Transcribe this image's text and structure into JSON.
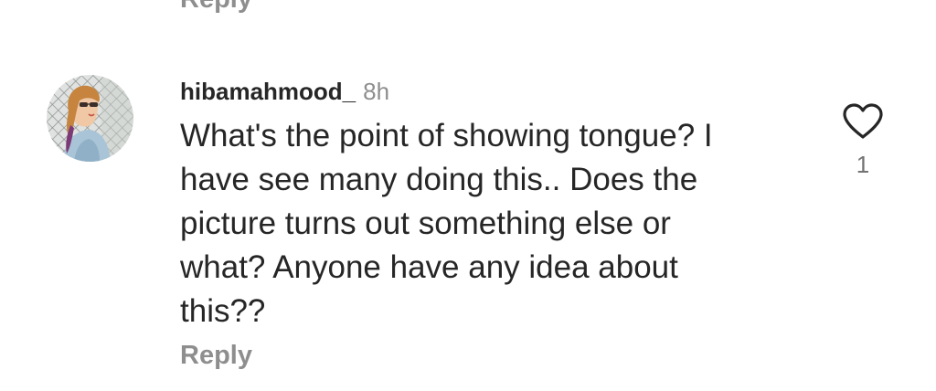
{
  "previous_comment": {
    "reply_label": "Reply"
  },
  "comment": {
    "username": "hibamahmood_",
    "timestamp": "8h",
    "text": "What's the point of showing tongue? I\nhave see many doing this.. Does the\npicture turns out something else or\nwhat? Anyone have any idea about\nthis??",
    "reply_label": "Reply",
    "like_count": "1",
    "like_icon": "heart-outline-icon",
    "colors": {
      "primary_text": "#262626",
      "secondary_text": "#8e8e8e",
      "icon": "#262626"
    }
  }
}
